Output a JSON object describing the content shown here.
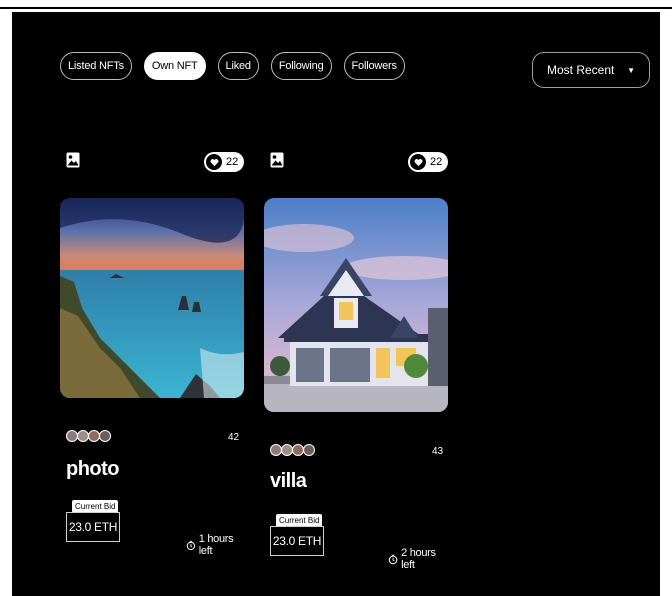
{
  "tabs": [
    {
      "label": "Listed NFTs",
      "active": false
    },
    {
      "label": "Own NFT",
      "active": true
    },
    {
      "label": "Liked",
      "active": false
    },
    {
      "label": "Following",
      "active": false
    },
    {
      "label": "Followers",
      "active": false
    }
  ],
  "sort": {
    "selected": "Most Recent"
  },
  "cards": [
    {
      "likes": "22",
      "count": "42",
      "name": "photo",
      "bid_label": "Current Bid",
      "bid_value": "23.0 ETH",
      "time_left": "1 hours left"
    },
    {
      "likes": "22",
      "count": "43",
      "name": "villa",
      "bid_label": "Current Bid",
      "bid_value": "23.0 ETH",
      "time_left": "2 hours left"
    }
  ],
  "colors": {
    "background": "#000000",
    "accent": "#ffffff"
  }
}
